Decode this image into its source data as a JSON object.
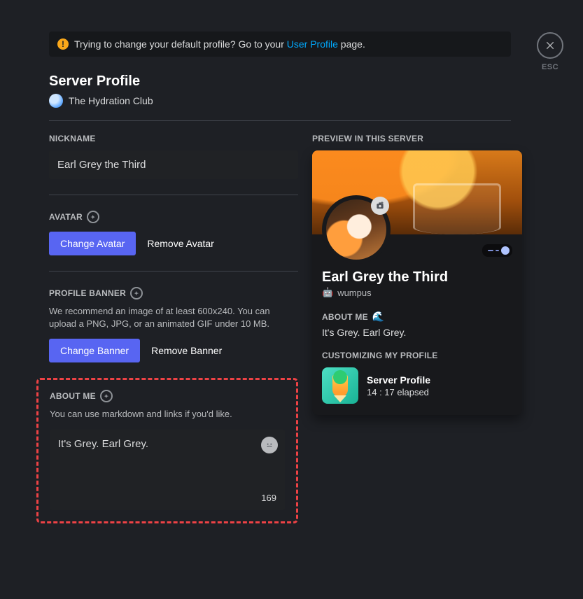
{
  "notice": {
    "text_before": "Trying to change your default profile? Go to your ",
    "link_text": "User Profile",
    "text_after": " page."
  },
  "page_title": "Server Profile",
  "server_name": "The Hydration Club",
  "esc_label": "ESC",
  "left": {
    "nickname_label": "NICKNAME",
    "nickname_value": "Earl Grey the Third",
    "avatar_label": "AVATAR",
    "change_avatar": "Change Avatar",
    "remove_avatar": "Remove Avatar",
    "banner_label": "PROFILE BANNER",
    "banner_help": "We recommend an image of at least 600x240. You can upload a PNG, JPG, or an animated GIF under 10 MB.",
    "change_banner": "Change Banner",
    "remove_banner": "Remove Banner",
    "about_label": "ABOUT ME",
    "about_help": "You can use markdown and links if you'd like.",
    "about_value": "It's Grey. Earl Grey.",
    "about_count": "169"
  },
  "preview": {
    "heading": "PREVIEW IN THIS SERVER",
    "display_name": "Earl Grey the Third",
    "username": "wumpus",
    "about_heading": "ABOUT ME",
    "about_text": "It's Grey. Earl Grey.",
    "activity_heading": "CUSTOMIZING MY PROFILE",
    "activity_title": "Server Profile",
    "activity_time": "14 : 17 elapsed"
  }
}
